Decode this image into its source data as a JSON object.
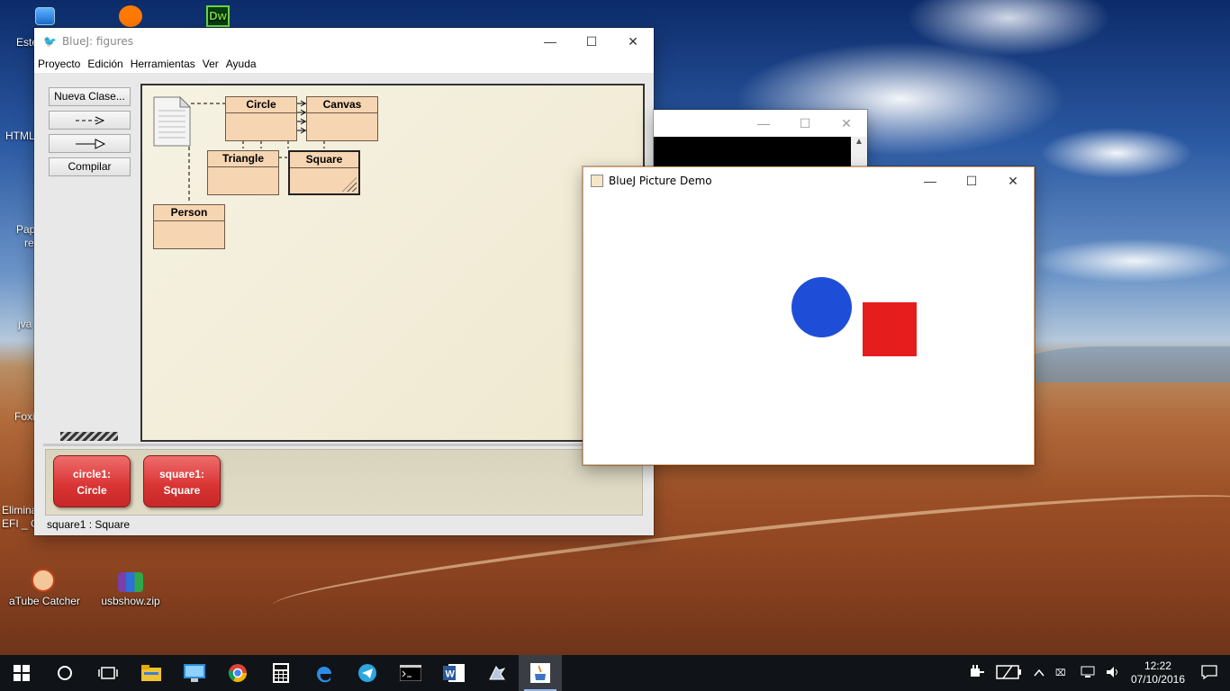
{
  "desktop": {
    "icons": [
      {
        "label": "Este"
      },
      {
        "label": "HTML"
      },
      {
        "label": "Pap"
      },
      {
        "label": "re"
      },
      {
        "label": "jva"
      },
      {
        "label": "Foxi"
      },
      {
        "label": "Elimina"
      },
      {
        "label": "EFI _ G"
      },
      {
        "label": "aTube Catcher"
      },
      {
        "label": "usbshow.zip"
      }
    ],
    "dw_badge": "Dw"
  },
  "bluej": {
    "title": "BlueJ:  figures",
    "menu": [
      "Proyecto",
      "Edición",
      "Herramientas",
      "Ver",
      "Ayuda"
    ],
    "toolbar": {
      "new_class": "Nueva Clase...",
      "compile": "Compilar"
    },
    "classes": {
      "circle": "Circle",
      "canvas": "Canvas",
      "triangle": "Triangle",
      "square": "Square",
      "person": "Person"
    },
    "objects": [
      {
        "name": "circle1:",
        "type": "Circle"
      },
      {
        "name": "square1:",
        "type": "Square"
      }
    ],
    "status": "square1 : Square"
  },
  "demo": {
    "title": "BlueJ Picture Demo",
    "colors": {
      "circle": "#1e4ed8",
      "square": "#e51d1d"
    }
  },
  "window_controls": {
    "minimize": "—",
    "maximize": "☐",
    "close": "✕"
  },
  "taskbar": {
    "apps": [
      "start-icon",
      "cortana-icon",
      "task-view-icon",
      "file-explorer-icon",
      "lenovo-icon",
      "chrome-icon",
      "calculator-icon",
      "edge-icon",
      "telegram-icon",
      "cmd-icon",
      "word-icon",
      "bluej-icon",
      "java-icon"
    ],
    "time": "12:22",
    "date": "07/10/2016"
  }
}
